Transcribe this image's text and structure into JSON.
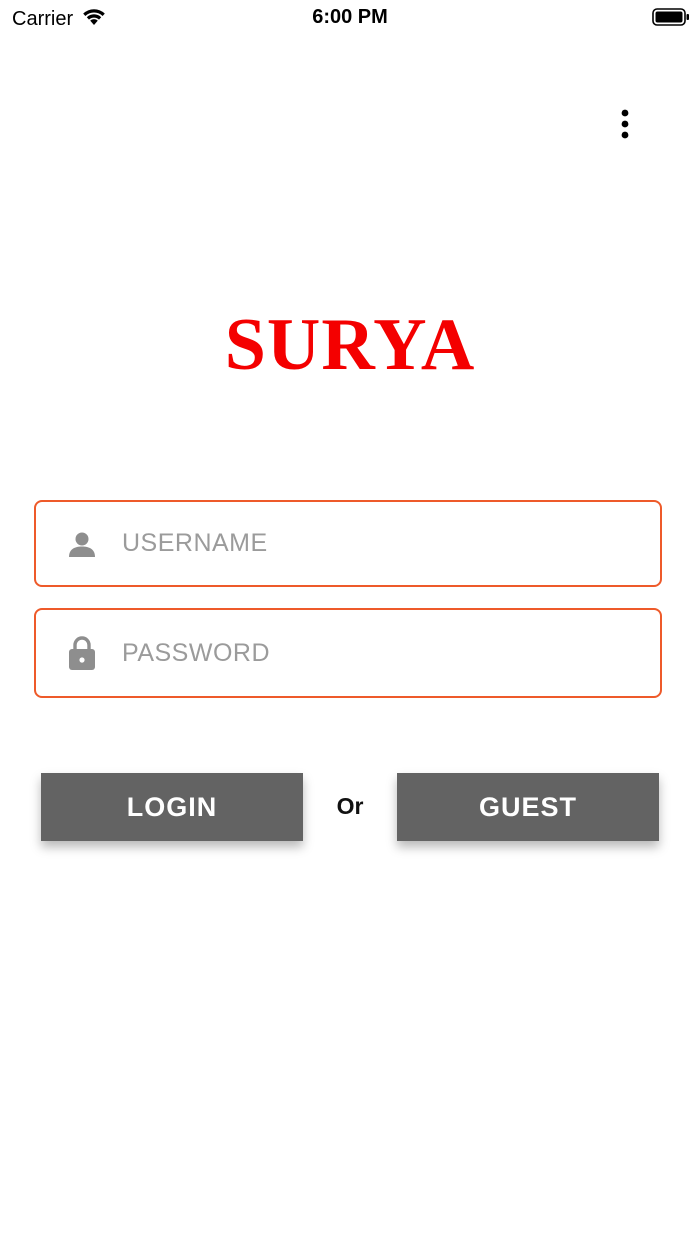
{
  "status_bar": {
    "carrier": "Carrier",
    "time": "6:00 PM",
    "icons": [
      "wifi-icon",
      "battery-icon"
    ]
  },
  "menu": {
    "icon": "more-vertical-icon"
  },
  "logo": {
    "text": "SURYA",
    "color": "#f40000"
  },
  "form": {
    "username": {
      "placeholder": "USERNAME",
      "value": "",
      "icon": "user-icon"
    },
    "password": {
      "placeholder": "PASSWORD",
      "value": "",
      "icon": "lock-icon"
    },
    "border_color": "#ee5a2a"
  },
  "actions": {
    "login_label": "LOGIN",
    "separator": "Or",
    "guest_label": "GUEST",
    "button_color": "#636363"
  }
}
